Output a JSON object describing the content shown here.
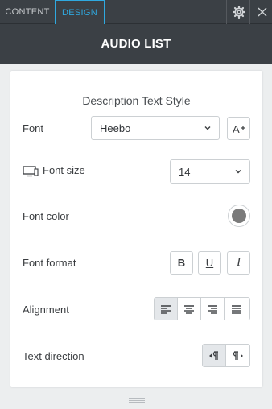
{
  "tabs": {
    "content": "CONTENT",
    "design": "DESIGN"
  },
  "header": {
    "title": "AUDIO LIST"
  },
  "panel": {
    "section_title": "Description Text Style",
    "font": {
      "label": "Font",
      "value": "Heebo"
    },
    "font_size": {
      "label": "Font size",
      "value": "14"
    },
    "font_color": {
      "label": "Font color",
      "value": "#7b7b7b"
    },
    "font_format": {
      "label": "Font format",
      "bold": "B",
      "underline": "U",
      "italic": "I"
    },
    "alignment": {
      "label": "Alignment",
      "selected": "left"
    },
    "text_direction": {
      "label": "Text direction",
      "selected": "ltr"
    }
  },
  "colors": {
    "accent": "#2fa9e0",
    "header_bg": "#3b4045",
    "page_bg": "#eceeef"
  },
  "icons": [
    "gear-icon",
    "close-icon",
    "font-size-increase-icon",
    "desktop-icon",
    "chevron-down-icon",
    "align-left-icon",
    "align-center-icon",
    "align-right-icon",
    "align-justify-icon",
    "ltr-icon",
    "rtl-icon"
  ]
}
